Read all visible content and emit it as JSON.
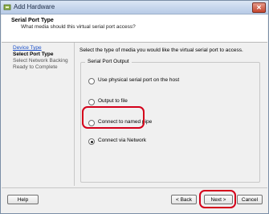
{
  "window": {
    "title": "Add Hardware",
    "app_icon": "hardware-icon",
    "close_icon": "close-icon",
    "close_glyph": "✕"
  },
  "header": {
    "title": "Serial Port Type",
    "subtitle": "What media should this virtual serial port access?"
  },
  "nav": {
    "items": [
      {
        "label": "Device Type",
        "state": "done"
      },
      {
        "label": "Select Port Type",
        "state": "current"
      },
      {
        "label": "Select Network Backing",
        "state": "future"
      },
      {
        "label": "Ready to Complete",
        "state": "future"
      }
    ]
  },
  "main": {
    "prompt": "Select the type of media you would like the virtual serial port to access.",
    "group_label": "Serial Port Output",
    "options": [
      {
        "label": "Use physical serial port on the host",
        "selected": false
      },
      {
        "label": "Output to file",
        "selected": false
      },
      {
        "label": "Connect to named pipe",
        "selected": false
      },
      {
        "label": "Connect via Network",
        "selected": true
      }
    ]
  },
  "footer": {
    "help_label": "Help",
    "back_label": "< Back",
    "next_label": "Next >",
    "cancel_label": "Cancel"
  },
  "colors": {
    "highlight": "#d4001a",
    "link": "#1a4fc9",
    "titlebar": "#c6d6ec"
  }
}
